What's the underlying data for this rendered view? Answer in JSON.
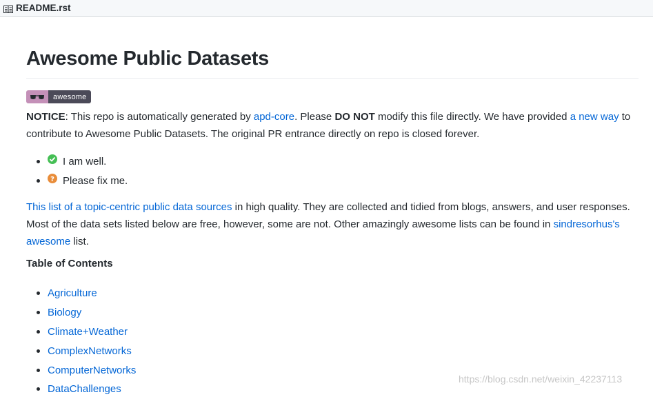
{
  "file_header": {
    "icon": "book-icon",
    "filename": "README.rst"
  },
  "title": "Awesome Public Datasets",
  "badge": {
    "icon": "sunglasses-icon",
    "label": "awesome",
    "colors": {
      "left": "#c490b8",
      "right": "#4b4a58"
    }
  },
  "notice": {
    "label": "NOTICE",
    "text1": ": This repo is automatically generated by ",
    "link1": "apd-core",
    "text2": ". Please ",
    "bold": "DO NOT",
    "text3": " modify this file directly. We have provided ",
    "link2": "a new way",
    "text4": " to contribute to Awesome Public Datasets. The original PR entrance directly on repo is closed forever."
  },
  "status_list": [
    {
      "icon": "check-circle-icon",
      "text": "I am well."
    },
    {
      "icon": "question-circle-icon",
      "text": "Please fix me."
    }
  ],
  "intro": {
    "link1": "This list of a topic-centric public data sources",
    "text1": " in high quality. They are collected and tidied from blogs, answers, and user responses. Most of the data sets listed below are free, however, some are not. Other amazingly awesome lists can be found in ",
    "link2": "sindresorhus's awesome",
    "text2": " list."
  },
  "toc": {
    "heading": "Table of Contents",
    "items": [
      "Agriculture",
      "Biology",
      "Climate+Weather",
      "ComplexNetworks",
      "ComputerNetworks",
      "DataChallenges"
    ]
  },
  "watermark": "https://blog.csdn.net/weixin_42237113",
  "colors": {
    "link": "#0366d6",
    "text": "#24292e",
    "ok": "#45bf55",
    "help": "#e98d3a"
  }
}
